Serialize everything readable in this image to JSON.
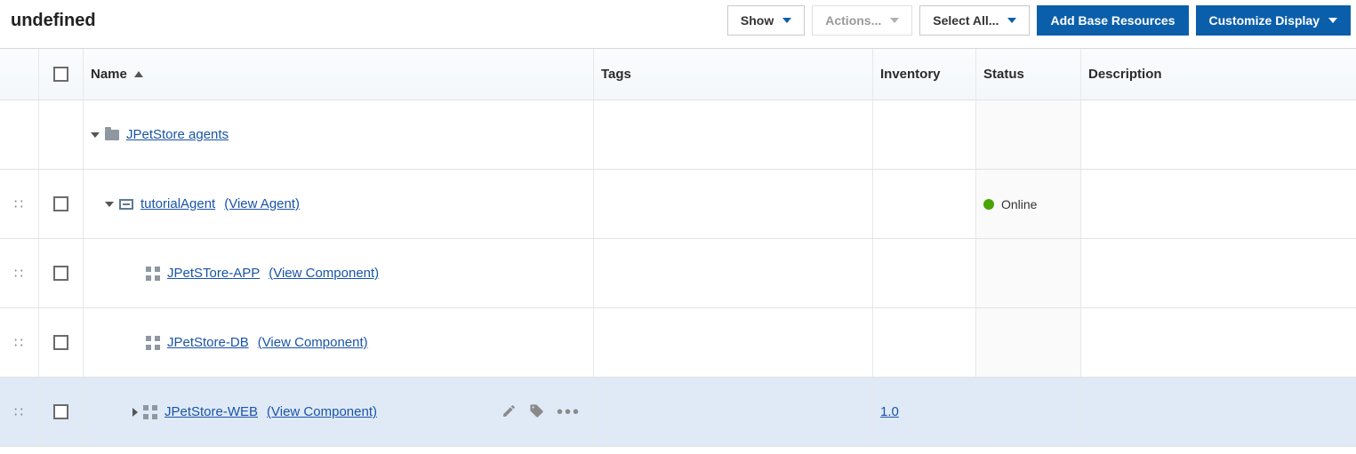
{
  "page_title": "undefined",
  "toolbar": {
    "show_label": "Show",
    "actions_label": "Actions...",
    "select_all_label": "Select All...",
    "add_base_resources_label": "Add Base Resources",
    "customize_display_label": "Customize Display"
  },
  "columns": {
    "name": "Name",
    "tags": "Tags",
    "inventory": "Inventory",
    "status": "Status",
    "description": "Description"
  },
  "status": {
    "online_label": "Online",
    "online_color": "#4aa500"
  },
  "rows": [
    {
      "name": "JPetStore agents",
      "view_label": "",
      "inventory": "",
      "status": ""
    },
    {
      "name": "tutorialAgent",
      "view_label": "(View Agent)",
      "inventory": "",
      "status": "online"
    },
    {
      "name": "JPetSTore-APP",
      "view_label": "(View Component)",
      "inventory": "",
      "status": ""
    },
    {
      "name": "JPetStore-DB",
      "view_label": "(View Component)",
      "inventory": "",
      "status": ""
    },
    {
      "name": "JPetStore-WEB",
      "view_label": "(View Component)",
      "inventory": "1.0",
      "status": ""
    }
  ]
}
